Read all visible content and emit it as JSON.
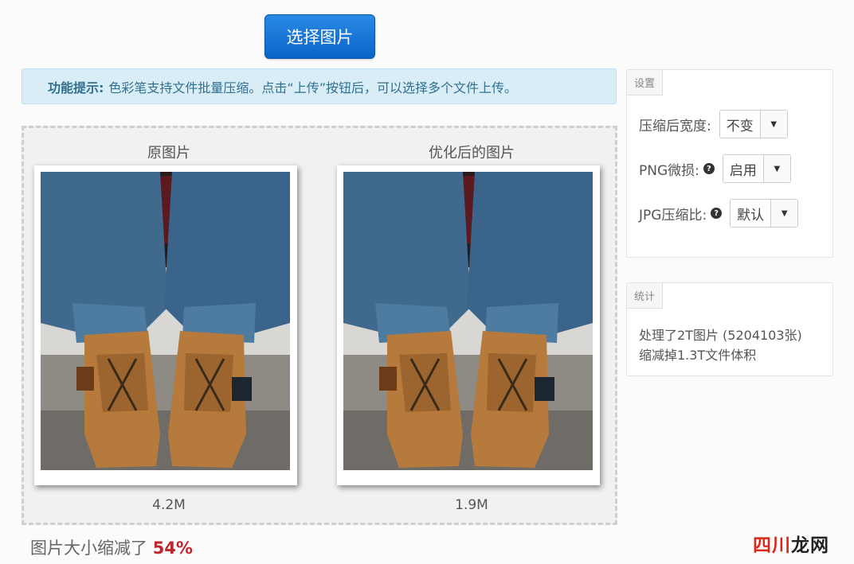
{
  "toolbar": {
    "select_label": "选择图片"
  },
  "tip": {
    "label": "功能提示:",
    "text": "色彩笔支持文件批量压缩。点击“上传”按钮后，可以选择多个文件上传。"
  },
  "compare": {
    "original": {
      "title": "原图片",
      "size": "4.2M"
    },
    "optimized": {
      "title": "优化后的图片",
      "size": "1.9M"
    }
  },
  "result": {
    "prefix": "图片大小缩减了",
    "percent": "54%"
  },
  "settings": {
    "tag": "设置",
    "width": {
      "label": "压缩后宽度:",
      "value": "不变"
    },
    "png": {
      "label": "PNG微损:",
      "value": "启用"
    },
    "jpg": {
      "label": "JPG压缩比:",
      "value": "默认"
    }
  },
  "stats": {
    "tag": "统计",
    "line1": "处理了2T图片 (5204103张)",
    "line2": "缩减掉1.3T文件体积"
  },
  "watermark": {
    "part1": "四川",
    "part2": "龙网"
  },
  "colors": {
    "accent": "#0a64c9",
    "tip_bg": "#d9edf7",
    "highlight": "#c0252d"
  }
}
